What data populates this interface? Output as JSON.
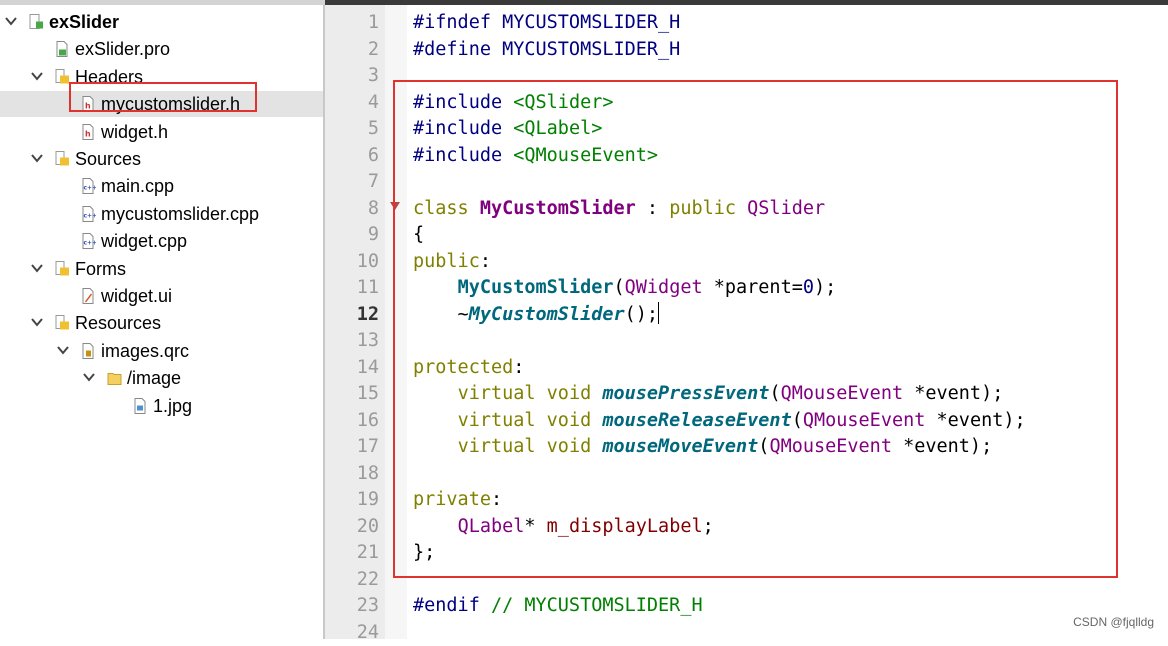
{
  "tree": [
    {
      "label": "exSlider",
      "icon": "project-icon",
      "chevron": "down",
      "bold": true
    },
    {
      "label": "exSlider.pro",
      "icon": "pro-file-icon"
    },
    {
      "label": "Headers",
      "icon": "headers-folder-icon",
      "chevron": "down"
    },
    {
      "label": "mycustomslider.h",
      "icon": "header-file-icon",
      "selected": true
    },
    {
      "label": "widget.h",
      "icon": "header-file-icon"
    },
    {
      "label": "Sources",
      "icon": "sources-folder-icon",
      "chevron": "down"
    },
    {
      "label": "main.cpp",
      "icon": "cpp-file-icon"
    },
    {
      "label": "mycustomslider.cpp",
      "icon": "cpp-file-icon"
    },
    {
      "label": "widget.cpp",
      "icon": "cpp-file-icon"
    },
    {
      "label": "Forms",
      "icon": "forms-folder-icon",
      "chevron": "down"
    },
    {
      "label": "widget.ui",
      "icon": "ui-file-icon"
    },
    {
      "label": "Resources",
      "icon": "resources-folder-icon",
      "chevron": "down"
    },
    {
      "label": "images.qrc",
      "icon": "qrc-file-icon",
      "chevron": "down"
    },
    {
      "label": "/image",
      "icon": "folder-icon",
      "chevron": "down"
    },
    {
      "label": "1.jpg",
      "icon": "image-file-icon"
    }
  ],
  "editor": {
    "current_line": "12",
    "lines": [
      {
        "num": "1",
        "tokens": [
          {
            "t": "#ifndef MYCUSTOMSLIDER_H",
            "c": "pre"
          }
        ]
      },
      {
        "num": "2",
        "tokens": [
          {
            "t": "#define MYCUSTOMSLIDER_H",
            "c": "pre"
          }
        ]
      },
      {
        "num": "3",
        "tokens": []
      },
      {
        "num": "4",
        "tokens": [
          {
            "t": "#include ",
            "c": "pre"
          },
          {
            "t": "<QSlider>",
            "c": "inc"
          }
        ]
      },
      {
        "num": "5",
        "tokens": [
          {
            "t": "#include ",
            "c": "pre"
          },
          {
            "t": "<QLabel>",
            "c": "inc"
          }
        ]
      },
      {
        "num": "6",
        "tokens": [
          {
            "t": "#include ",
            "c": "pre"
          },
          {
            "t": "<QMouseEvent>",
            "c": "inc"
          }
        ]
      },
      {
        "num": "7",
        "tokens": []
      },
      {
        "num": "8",
        "tokens": [
          {
            "t": "class ",
            "c": "kw"
          },
          {
            "t": "MyCustomSlider",
            "c": "cls"
          },
          {
            "t": " : ",
            "c": "pl"
          },
          {
            "t": "public ",
            "c": "kw"
          },
          {
            "t": "QSlider",
            "c": "type"
          }
        ]
      },
      {
        "num": "9",
        "tokens": [
          {
            "t": "{",
            "c": "pl"
          }
        ]
      },
      {
        "num": "10",
        "tokens": [
          {
            "t": "public",
            "c": "kw"
          },
          {
            "t": ":",
            "c": "pl"
          }
        ]
      },
      {
        "num": "11",
        "tokens": [
          {
            "t": "    ",
            "c": "pl"
          },
          {
            "t": "MyCustomSlider",
            "c": "fn"
          },
          {
            "t": "(",
            "c": "pl"
          },
          {
            "t": "QWidget",
            "c": "type"
          },
          {
            "t": " *parent=",
            "c": "pl"
          },
          {
            "t": "0",
            "c": "num"
          },
          {
            "t": ");",
            "c": "pl"
          }
        ]
      },
      {
        "num": "12",
        "tokens": [
          {
            "t": "    ~",
            "c": "pl"
          },
          {
            "t": "MyCustomSlider",
            "c": "fni"
          },
          {
            "t": "();",
            "c": "pl"
          }
        ],
        "cursor": true
      },
      {
        "num": "13",
        "tokens": []
      },
      {
        "num": "14",
        "tokens": [
          {
            "t": "protected",
            "c": "kw"
          },
          {
            "t": ":",
            "c": "pl"
          }
        ]
      },
      {
        "num": "15",
        "tokens": [
          {
            "t": "    ",
            "c": "pl"
          },
          {
            "t": "virtual void ",
            "c": "kw"
          },
          {
            "t": "mousePressEvent",
            "c": "fni"
          },
          {
            "t": "(",
            "c": "pl"
          },
          {
            "t": "QMouseEvent",
            "c": "type"
          },
          {
            "t": " *event);",
            "c": "pl"
          }
        ]
      },
      {
        "num": "16",
        "tokens": [
          {
            "t": "    ",
            "c": "pl"
          },
          {
            "t": "virtual void ",
            "c": "kw"
          },
          {
            "t": "mouseReleaseEvent",
            "c": "fni"
          },
          {
            "t": "(",
            "c": "pl"
          },
          {
            "t": "QMouseEvent",
            "c": "type"
          },
          {
            "t": " *event);",
            "c": "pl"
          }
        ]
      },
      {
        "num": "17",
        "tokens": [
          {
            "t": "    ",
            "c": "pl"
          },
          {
            "t": "virtual void ",
            "c": "kw"
          },
          {
            "t": "mouseMoveEvent",
            "c": "fni"
          },
          {
            "t": "(",
            "c": "pl"
          },
          {
            "t": "QMouseEvent",
            "c": "type"
          },
          {
            "t": " *event);",
            "c": "pl"
          }
        ]
      },
      {
        "num": "18",
        "tokens": []
      },
      {
        "num": "19",
        "tokens": [
          {
            "t": "private",
            "c": "kw"
          },
          {
            "t": ":",
            "c": "pl"
          }
        ]
      },
      {
        "num": "20",
        "tokens": [
          {
            "t": "    ",
            "c": "pl"
          },
          {
            "t": "QLabel",
            "c": "type"
          },
          {
            "t": "* ",
            "c": "pl"
          },
          {
            "t": "m_displayLabel",
            "c": "mem"
          },
          {
            "t": ";",
            "c": "pl"
          }
        ]
      },
      {
        "num": "21",
        "tokens": [
          {
            "t": "};",
            "c": "pl"
          }
        ]
      },
      {
        "num": "22",
        "tokens": []
      },
      {
        "num": "23",
        "tokens": [
          {
            "t": "#endif ",
            "c": "pre"
          },
          {
            "t": "// MYCUSTOMSLIDER_H",
            "c": "cmt"
          }
        ]
      },
      {
        "num": "24",
        "tokens": []
      }
    ]
  },
  "colors": {
    "highlight_box": "#e0332f",
    "selection_bg": "#e3e3e3"
  },
  "watermark": "CSDN @fjqlldg"
}
